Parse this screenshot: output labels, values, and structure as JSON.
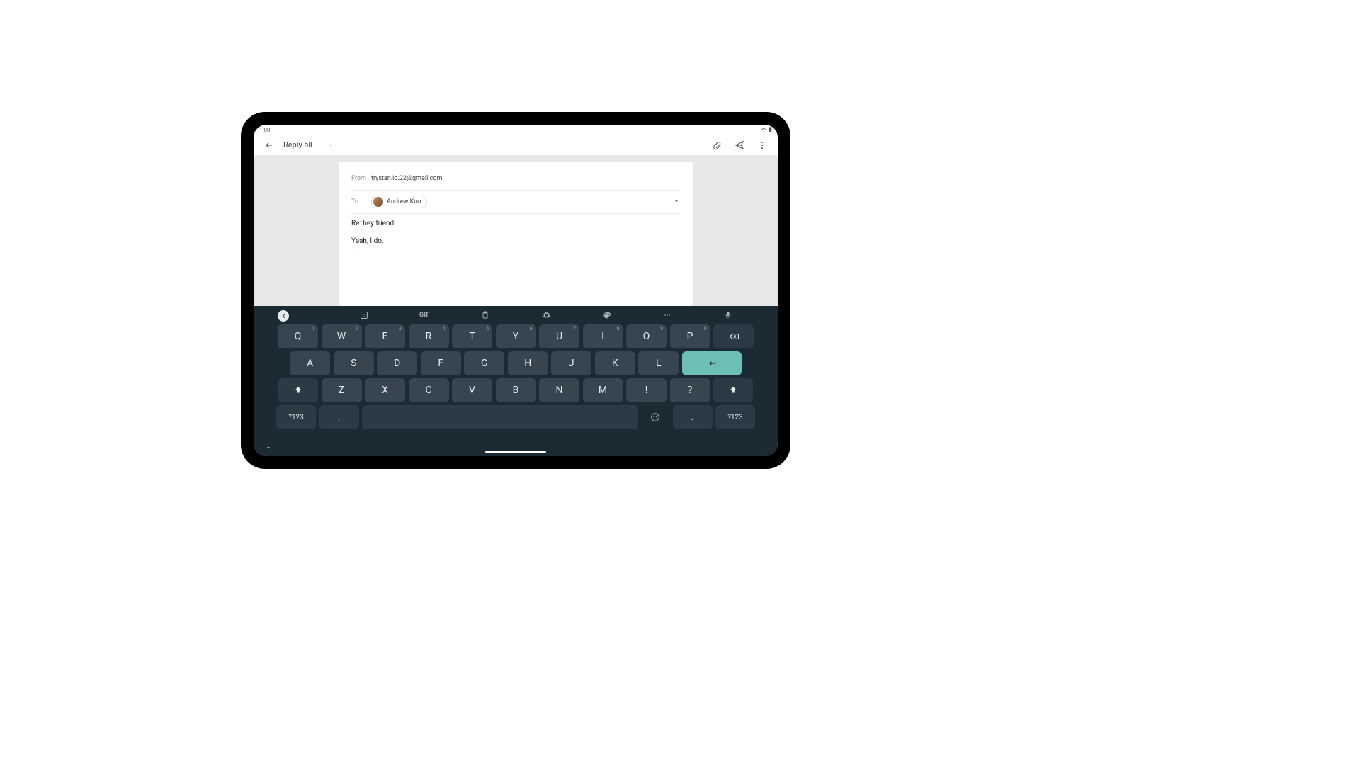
{
  "status": {
    "time": "1:00"
  },
  "appbar": {
    "title": "Reply all"
  },
  "compose": {
    "from_label": "From",
    "from_value": "trystan.io.22@gmail.com",
    "to_label": "To",
    "recipient_name": "Andrew Kuo",
    "subject": "Re: hey friend!",
    "body": "Yeah, I do.",
    "quoted": "…"
  },
  "keyboard": {
    "gif_label": "GIF",
    "row1": [
      {
        "k": "Q",
        "a": "1"
      },
      {
        "k": "W",
        "a": "2"
      },
      {
        "k": "E",
        "a": "3"
      },
      {
        "k": "R",
        "a": "4"
      },
      {
        "k": "T",
        "a": "5"
      },
      {
        "k": "Y",
        "a": "6"
      },
      {
        "k": "U",
        "a": "7"
      },
      {
        "k": "I",
        "a": "8"
      },
      {
        "k": "O",
        "a": "9"
      },
      {
        "k": "P",
        "a": "0"
      }
    ],
    "row2": [
      "A",
      "S",
      "D",
      "F",
      "G",
      "H",
      "J",
      "K",
      "L"
    ],
    "row3": [
      "Z",
      "X",
      "C",
      "V",
      "B",
      "N",
      "M",
      "!",
      "?"
    ],
    "sym": "?123",
    "comma": ",",
    "period": "."
  }
}
